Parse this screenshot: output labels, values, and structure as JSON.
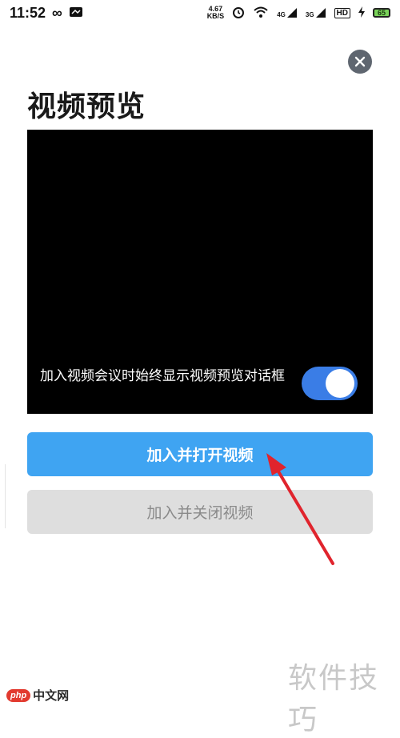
{
  "status_bar": {
    "time": "11:52",
    "net_speed_value": "4.67",
    "net_speed_unit": "KB/S",
    "signal1": "4G",
    "signal2": "3G",
    "hd": "HD",
    "battery": "65"
  },
  "dialog": {
    "title": "视频预览",
    "preview_option_label": "加入视频会议时始终显示视频预览对话框",
    "toggle_on": true,
    "join_with_video_label": "加入并打开视频",
    "join_without_video_label": "加入并关闭视频"
  },
  "watermark": {
    "site_text": "软件技巧",
    "logo_badge": "php",
    "logo_text": "中文网"
  },
  "colors": {
    "primary_button": "#3fa4f2",
    "secondary_button": "#dedede",
    "toggle": "#3a7de6",
    "annotation_arrow": "#e0242d"
  }
}
